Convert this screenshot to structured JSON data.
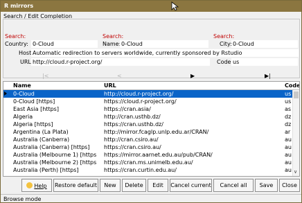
{
  "window": {
    "title": "R mirrors"
  },
  "group": {
    "title": "Search / Edit Completion"
  },
  "search": {
    "label": "Search:",
    "country_label": "Country:",
    "country_value": "0-Cloud",
    "name_label": "Name:",
    "name_value": "0-Cloud",
    "city_label": "City:",
    "city_value": "0-Cloud",
    "host_label": "Host:",
    "host_value": "Automatic redirection to servers worldwide, currently sponsored by Rstudio",
    "url_label": "URL:",
    "url_value": "http://cloud.r-project.org/",
    "code_label": "Code:",
    "code_value": "us"
  },
  "nav": {
    "first": "|<",
    "prev": "<",
    "next": "▶",
    "last": "▶|"
  },
  "grid": {
    "columns": [
      "Name",
      "URL",
      "Code"
    ],
    "rows": [
      {
        "name": "0-Cloud",
        "url": "http://cloud.r-project.org/",
        "code": "us"
      },
      {
        "name": "0-Cloud [https]",
        "url": "https://cloud.r-project.org/",
        "code": "us"
      },
      {
        "name": "East Asia [https]",
        "url": "https://cran.asia/",
        "code": "as"
      },
      {
        "name": "Algeria",
        "url": "http://cran.usthb.dz/",
        "code": "dz"
      },
      {
        "name": "Algeria [https]",
        "url": "https://cran.usthb.dz/",
        "code": "dz"
      },
      {
        "name": "Argentina (La Plata)",
        "url": "http://mirror.fcaglp.unlp.edu.ar/CRAN/",
        "code": "ar"
      },
      {
        "name": "Australia (Canberra)",
        "url": "http://cran.csiro.au/",
        "code": "au"
      },
      {
        "name": "Australia (Canberra) [https]",
        "url": "https://cran.csiro.au/",
        "code": "au"
      },
      {
        "name": "Australia (Melbourne 1) [https",
        "url": "https://mirror.aarnet.edu.au/pub/CRAN/",
        "code": "au"
      },
      {
        "name": "Australia (Melbourne 2) [https",
        "url": "https://cran.ms.unimelb.edu.au/",
        "code": "au"
      },
      {
        "name": "Australia (Perth) [https]",
        "url": "https://cran.curtin.edu.au/",
        "code": "au"
      }
    ]
  },
  "buttons": {
    "help": "Help",
    "restore": "Restore default",
    "new": "New",
    "delete": "Delete",
    "edit": "Edit",
    "cancel_current": "Cancel current",
    "cancel_all": "Cancel all",
    "save": "Save",
    "close": "Close"
  },
  "status": {
    "text": "Browse mode"
  }
}
